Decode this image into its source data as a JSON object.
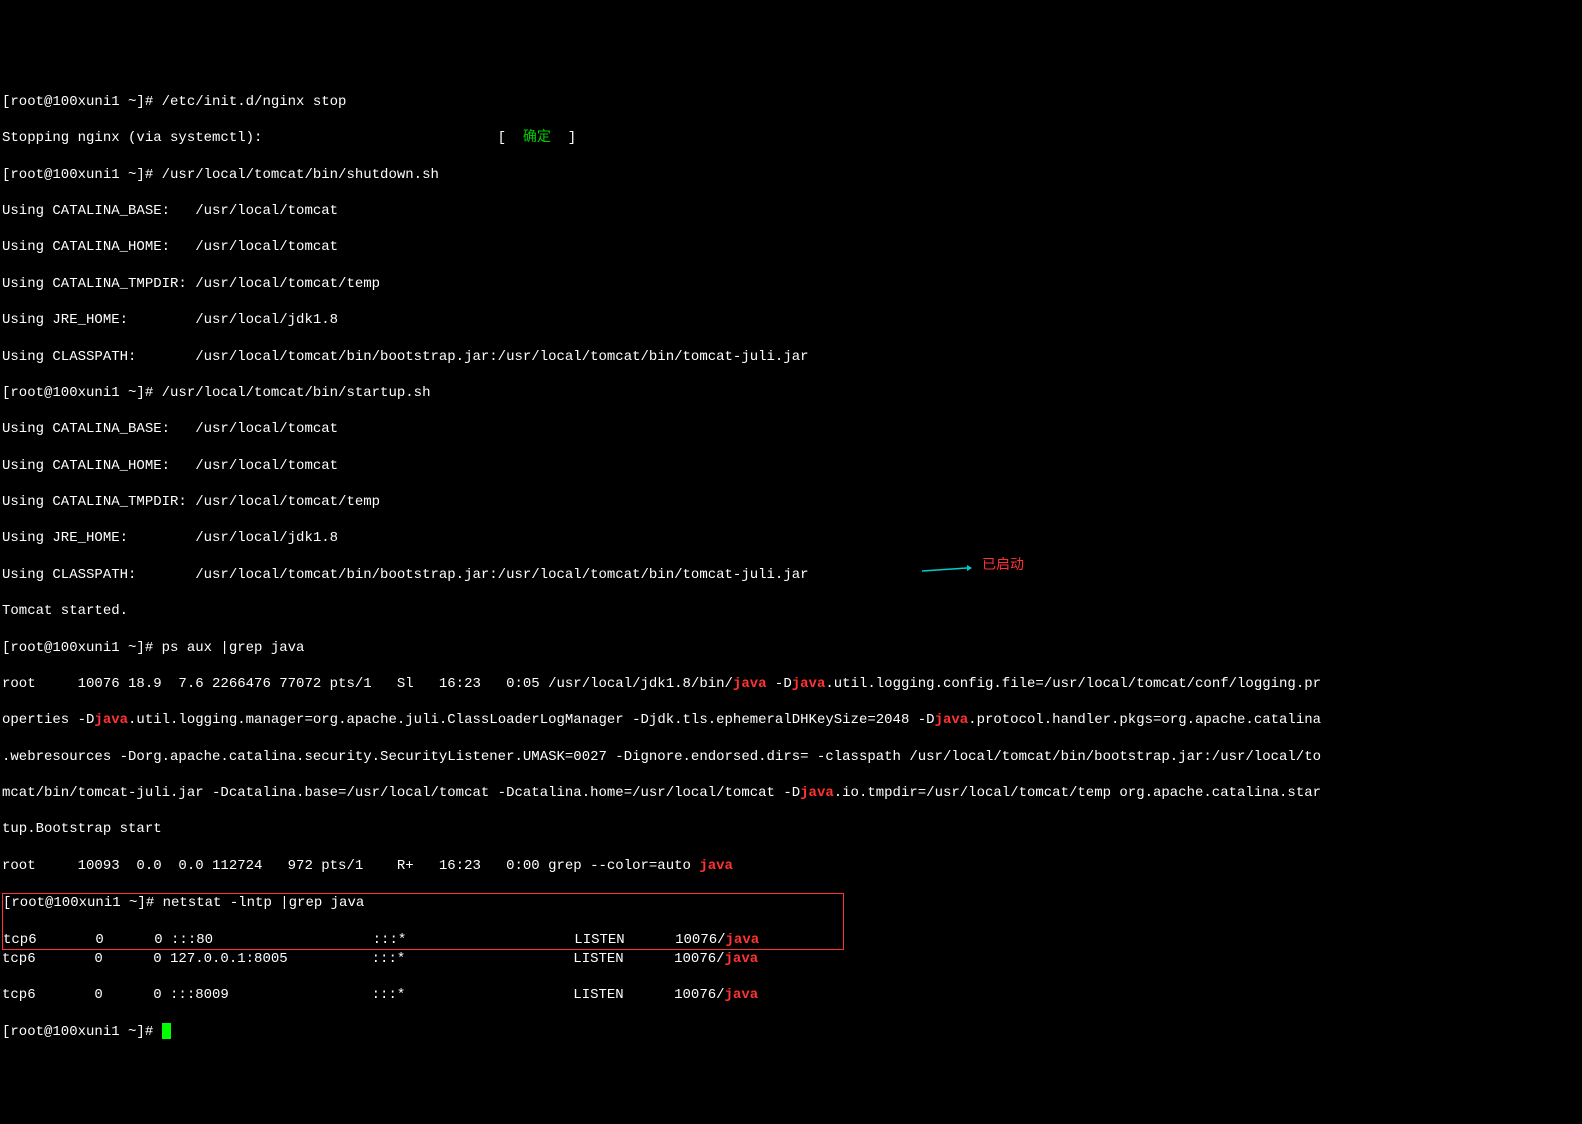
{
  "prompt": "[root@100xuni1 ~]# ",
  "lines": {
    "l1": "[root@100xuni1 ~]# /etc/init.d/nginx stop",
    "l2a": "Stopping nginx (via systemctl):                            [  ",
    "l2b": "确定",
    "l2c": "  ]",
    "l3": "[root@100xuni1 ~]# /usr/local/tomcat/bin/shutdown.sh",
    "l4": "Using CATALINA_BASE:   /usr/local/tomcat",
    "l5": "Using CATALINA_HOME:   /usr/local/tomcat",
    "l6": "Using CATALINA_TMPDIR: /usr/local/tomcat/temp",
    "l7": "Using JRE_HOME:        /usr/local/jdk1.8",
    "l8": "Using CLASSPATH:       /usr/local/tomcat/bin/bootstrap.jar:/usr/local/tomcat/bin/tomcat-juli.jar",
    "l9": "[root@100xuni1 ~]# /usr/local/tomcat/bin/startup.sh",
    "l10": "Using CATALINA_BASE:   /usr/local/tomcat",
    "l11": "Using CATALINA_HOME:   /usr/local/tomcat",
    "l12": "Using CATALINA_TMPDIR: /usr/local/tomcat/temp",
    "l13": "Using JRE_HOME:        /usr/local/jdk1.8",
    "l14": "Using CLASSPATH:       /usr/local/tomcat/bin/bootstrap.jar:/usr/local/tomcat/bin/tomcat-juli.jar",
    "l15": "Tomcat started.",
    "l16": "[root@100xuni1 ~]# ps aux |grep java",
    "l17a": "root     10076 18.9  7.6 2266476 77072 pts/1   Sl   16:23   0:05 /usr/local/jdk1.8/bin/",
    "l17b": "java",
    "l17c": " -D",
    "l17d": "java",
    "l17e": ".util.logging.config.file=/usr/local/tomcat/conf/logging.pr",
    "l18a": "operties -D",
    "l18b": "java",
    "l18c": ".util.logging.manager=org.apache.juli.ClassLoaderLogManager -Djdk.tls.ephemeralDHKeySize=2048 -D",
    "l18d": "java",
    "l18e": ".protocol.handler.pkgs=org.apache.catalina",
    "l19": ".webresources -Dorg.apache.catalina.security.SecurityListener.UMASK=0027 -Dignore.endorsed.dirs= -classpath /usr/local/tomcat/bin/bootstrap.jar:/usr/local/to",
    "l20a": "mcat/bin/tomcat-juli.jar -Dcatalina.base=/usr/local/tomcat -Dcatalina.home=/usr/local/tomcat -D",
    "l20b": "java",
    "l20c": ".io.tmpdir=/usr/local/tomcat/temp org.apache.catalina.star",
    "l21": "tup.Bootstrap start",
    "l22a": "root     10093  0.0  0.0 112724   972 pts/1    R+   16:23   0:00 grep --color=auto ",
    "l22b": "java",
    "l23": "[root@100xuni1 ~]# netstat -lntp |grep java",
    "l24a": "tcp6       0      0 :::80                   :::*                    LISTEN      10076/",
    "l24b": "java",
    "l24c": "          ",
    "l25a": "tcp6       0      0 127.0.0.1:8005          :::*                    LISTEN      10076/",
    "l25b": "java",
    "l25c": "          ",
    "l26a": "tcp6       0      0 :::8009                 :::*                    LISTEN      10076/",
    "l26b": "java",
    "l26c": "          ",
    "l27": "[root@100xuni1 ~]# "
  },
  "annotation": "已启动"
}
